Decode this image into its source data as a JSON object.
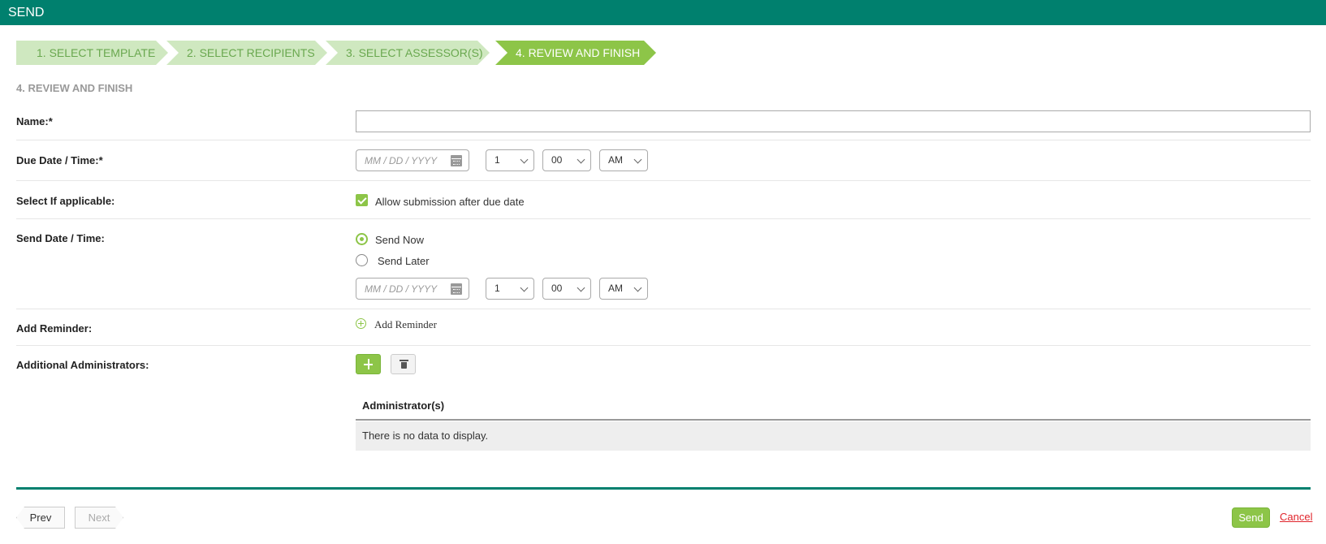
{
  "header": {
    "title": "SEND"
  },
  "steps": [
    {
      "label": "1. SELECT TEMPLATE"
    },
    {
      "label": "2. SELECT RECIPIENTS"
    },
    {
      "label": "3. SELECT ASSESSOR(S)"
    },
    {
      "label": "4. REVIEW AND FINISH",
      "active": true
    }
  ],
  "section_title": "4. REVIEW AND FINISH",
  "form": {
    "name": {
      "label": "Name:*",
      "value": ""
    },
    "due": {
      "label": "Due Date / Time:*",
      "date_placeholder": "MM / DD / YYYY",
      "hour": "1",
      "minute": "00",
      "ampm": "AM"
    },
    "applicable": {
      "label": "Select If applicable:",
      "checkbox_label": "Allow submission after due date",
      "checked": true
    },
    "send": {
      "label": "Send Date / Time:",
      "now_label": "Send Now",
      "later_label": "Send Later",
      "selected": "now",
      "date_placeholder": "MM / DD / YYYY",
      "hour": "1",
      "minute": "00",
      "ampm": "AM"
    },
    "reminder": {
      "label": "Add Reminder:",
      "link": "Add  Reminder"
    },
    "admins": {
      "label": "Additional Administrators:",
      "column": "Administrator(s)",
      "empty": "There is no data to display."
    }
  },
  "footer": {
    "prev": "Prev",
    "next": "Next",
    "send": "Send",
    "cancel": "Cancel"
  },
  "colors": {
    "brand": "#00806e",
    "accent": "#8dc548",
    "step_inactive": "#cfe8c0",
    "danger": "#e0242b"
  }
}
